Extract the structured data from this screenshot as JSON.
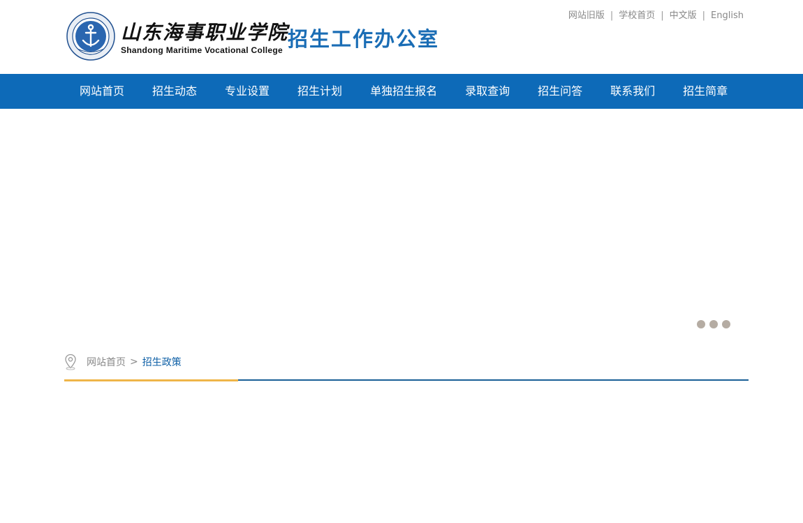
{
  "header": {
    "college_name_cn": "山东海事职业学院",
    "college_name_en": "Shandong Maritime Vocational College",
    "office_title": "招生工作办公室",
    "seal_icon": "anchor-seal-icon",
    "top_links": [
      {
        "label": "网站旧版"
      },
      {
        "label": "学校首页"
      },
      {
        "label": "中文版"
      },
      {
        "label": "English"
      }
    ],
    "separator": "|"
  },
  "nav": {
    "items": [
      {
        "label": "网站首页"
      },
      {
        "label": "招生动态"
      },
      {
        "label": "专业设置"
      },
      {
        "label": "招生计划"
      },
      {
        "label": "单独招生报名"
      },
      {
        "label": "录取查询"
      },
      {
        "label": "招生问答"
      },
      {
        "label": "联系我们"
      },
      {
        "label": "招生简章"
      }
    ]
  },
  "banner": {
    "slide_count": 3
  },
  "breadcrumb": {
    "icon": "location-pin-icon",
    "home": "网站首页",
    "separator": ">",
    "current": "招生政策"
  },
  "colors": {
    "nav_bg": "#0d6ab8",
    "office_title": "#1a6db5",
    "rule_blue": "#1a5f96",
    "rule_gold": "#efb548",
    "dot": "#b5aca3"
  }
}
